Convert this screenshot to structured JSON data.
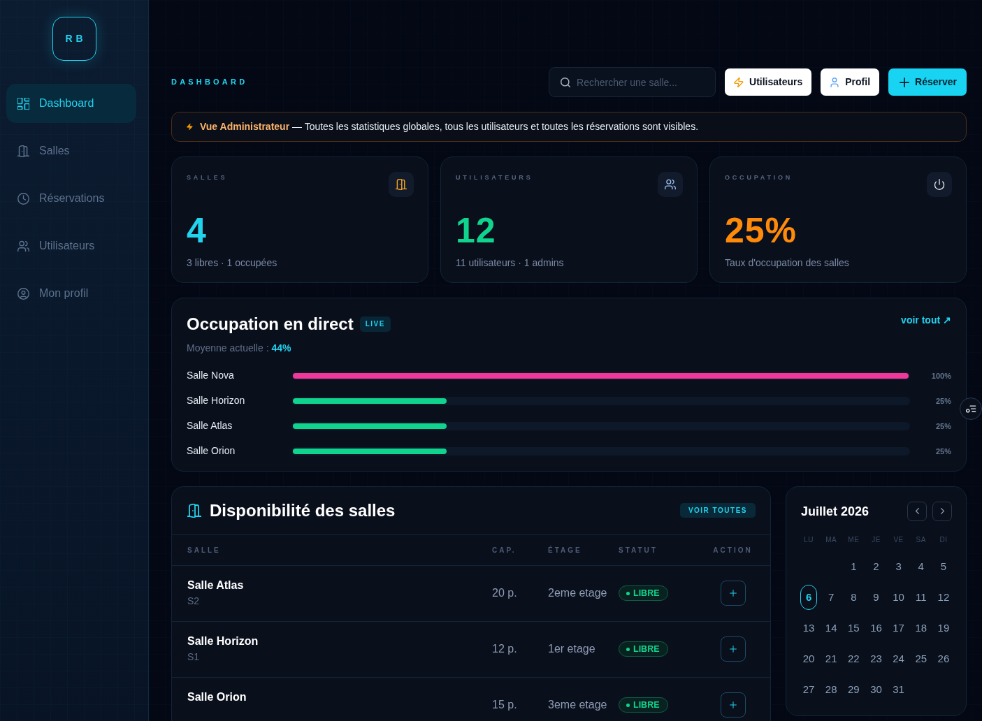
{
  "sidebar": {
    "logo": "RB",
    "items": [
      {
        "label": "Dashboard",
        "selected": true
      },
      {
        "label": "Salles",
        "selected": false
      },
      {
        "label": "Réservations",
        "selected": false
      },
      {
        "label": "Utilisateurs",
        "selected": false
      },
      {
        "label": "Mon profil",
        "selected": false
      }
    ]
  },
  "header": {
    "title": "DASHBOARD",
    "search": {
      "placeholder": "Rechercher une salle..."
    },
    "buttons": [
      {
        "label": "Utilisateurs",
        "kind": "light"
      },
      {
        "label": "Profil",
        "kind": "light"
      },
      {
        "label": "Réserver",
        "kind": "primary"
      }
    ]
  },
  "alert": {
    "text": "**Vue Administrateur** — Toutes les statistiques globales, tous les utilisateurs et toutes les réservations sont visibles."
  },
  "stats": [
    {
      "label": "SALLES",
      "value": "4",
      "detail": "3 libres · 1 occupées",
      "color": "#22d3ee"
    },
    {
      "label": "UTILISATEURS",
      "value": "12",
      "detail": "11 utilisateurs · 1 admins",
      "color": "#10d48e"
    },
    {
      "label": "OCCUPATION",
      "value": "25%",
      "detail": "Taux d'occupation des salles",
      "color": "#ff8a0a"
    }
  ],
  "occupation": {
    "title": "Occupation en direct",
    "badge": "LIVE",
    "link": "voir tout ↗",
    "average": "Moyenne actuelle : **44%**",
    "rooms": [
      {
        "name": "Salle Nova",
        "level": 1.0,
        "reading": "100%",
        "color": "#f0389b"
      },
      {
        "name": "Salle Horizon",
        "level": 0.25,
        "reading": "25%",
        "color": "#10d48e"
      },
      {
        "name": "Salle Atlas",
        "level": 0.25,
        "reading": "25%",
        "color": "#10d48e"
      },
      {
        "name": "Salle Orion",
        "level": 0.25,
        "reading": "25%",
        "color": "#10d48e"
      }
    ]
  },
  "availability": {
    "title": "Disponibilité des salles",
    "button": "VOIR TOUTES",
    "columns": [
      "SALLE",
      "CAP.",
      "ÉTAGE",
      "STATUT",
      "ACTION"
    ],
    "rows": [
      {
        "name": "Salle Atlas",
        "code": "S2",
        "capacity": "20 p.",
        "floor": "2eme etage",
        "status": "LIBRE"
      },
      {
        "name": "Salle Horizon",
        "code": "S1",
        "capacity": "12 p.",
        "floor": "1er etage",
        "status": "LIBRE"
      },
      {
        "name": "Salle Orion",
        "capacity": "15 p.",
        "floor": "3eme etage",
        "status": "LIBRE"
      }
    ]
  },
  "calendar": {
    "title": "Juillet 2026",
    "weekdays": [
      "LU",
      "MA",
      "ME",
      "JE",
      "VE",
      "SA",
      "DI"
    ],
    "weeks": [
      [
        {
          "day": "1",
          "selected": false
        },
        {
          "day": "2",
          "selected": false
        },
        {
          "day": "3",
          "selected": false
        },
        {
          "day": "4",
          "selected": false
        },
        {
          "day": "5",
          "selected": false
        }
      ],
      [
        {
          "day": "6",
          "selected": true
        },
        {
          "day": "7",
          "selected": false
        },
        {
          "day": "8",
          "selected": false
        },
        {
          "day": "9",
          "selected": false
        },
        {
          "day": "10",
          "selected": false
        },
        {
          "day": "11",
          "selected": false
        },
        {
          "day": "12",
          "selected": false
        }
      ],
      [
        {
          "day": "13",
          "selected": false
        },
        {
          "day": "14",
          "selected": false
        },
        {
          "day": "15",
          "selected": false
        },
        {
          "day": "16",
          "selected": false
        },
        {
          "day": "17",
          "selected": false
        },
        {
          "day": "18",
          "selected": false
        },
        {
          "day": "19",
          "selected": false
        }
      ],
      [
        {
          "day": "20",
          "selected": false
        },
        {
          "day": "21",
          "selected": false
        },
        {
          "day": "22",
          "selected": false
        },
        {
          "day": "23",
          "selected": false
        },
        {
          "day": "24",
          "selected": false
        },
        {
          "day": "25",
          "selected": false
        },
        {
          "day": "26",
          "selected": false
        }
      ],
      [
        {
          "day": "27",
          "selected": false
        },
        {
          "day": "28",
          "selected": false
        },
        {
          "day": "29",
          "selected": false
        },
        {
          "day": "30",
          "selected": false
        },
        {
          "day": "31",
          "selected": false
        }
      ]
    ]
  }
}
